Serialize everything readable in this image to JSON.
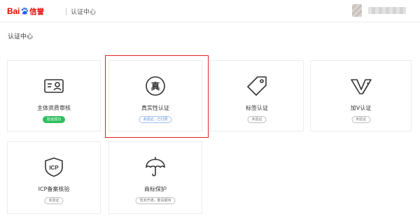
{
  "header": {
    "logo_text_left": "Bai",
    "logo_text_right": "信誉",
    "title": "认证中心"
  },
  "page": {
    "title": "认证中心"
  },
  "cards": [
    {
      "label": "主体资质审核",
      "status": "验证成功",
      "status_type": "success",
      "icon": "id-card-icon"
    },
    {
      "label": "真实性认证",
      "status": "未验证，已付费",
      "status_type": "pending",
      "icon": "zhen-seal-icon"
    },
    {
      "label": "标签认证",
      "status": "未验证",
      "status_type": "plain",
      "icon": "tag-icon"
    },
    {
      "label": "加V认证",
      "status": "未验证",
      "status_type": "plain",
      "icon": "v-badge-icon"
    },
    {
      "label": "ICP备案核验",
      "status": "未验证",
      "status_type": "plain",
      "icon": "icp-shield-icon",
      "icon_text": "ICP"
    },
    {
      "label": "商标保护",
      "status": "暂未开通，敬请期待",
      "status_type": "plain",
      "icon": "umbrella-icon"
    }
  ],
  "icon_zhen_text": "真",
  "colors": {
    "brand_red": "#e10601",
    "success_green": "#2fbf5f",
    "pending_blue": "#5b8fd8",
    "highlight_red": "#e62222"
  }
}
